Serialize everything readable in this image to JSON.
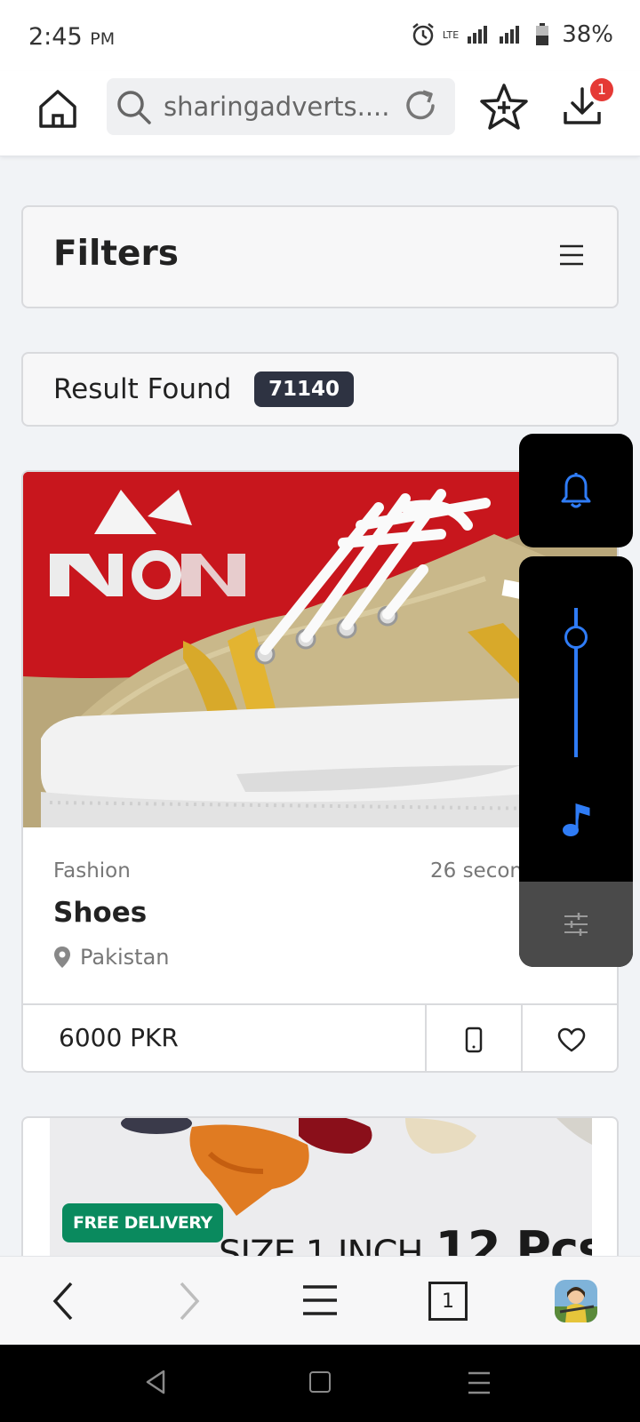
{
  "status_bar": {
    "time": "2:45",
    "time_suffix": "PM",
    "network": "LTE",
    "battery_percent": "38%"
  },
  "toolbar": {
    "url": "sharingadverts....",
    "download_badge": "1"
  },
  "filters": {
    "title": "Filters"
  },
  "results": {
    "label": "Result Found",
    "count": "71140"
  },
  "listing": {
    "category": "Fashion",
    "time": "26 secon",
    "title": "Shoes",
    "location": "Pakistan",
    "price": "6000 PKR"
  },
  "listing2": {
    "badge": "FREE DELIVERY",
    "size_text": "SIZE  1 INCH",
    "pcs_text": "12 Pcs"
  },
  "browser_nav": {
    "tab_count": "1"
  },
  "colors": {
    "accent_blue": "#2f7cf6",
    "badge_red": "#e53935",
    "count_badge": "#2e3342",
    "delivery_green": "#0a8a5e"
  },
  "volume_level": 0.82
}
